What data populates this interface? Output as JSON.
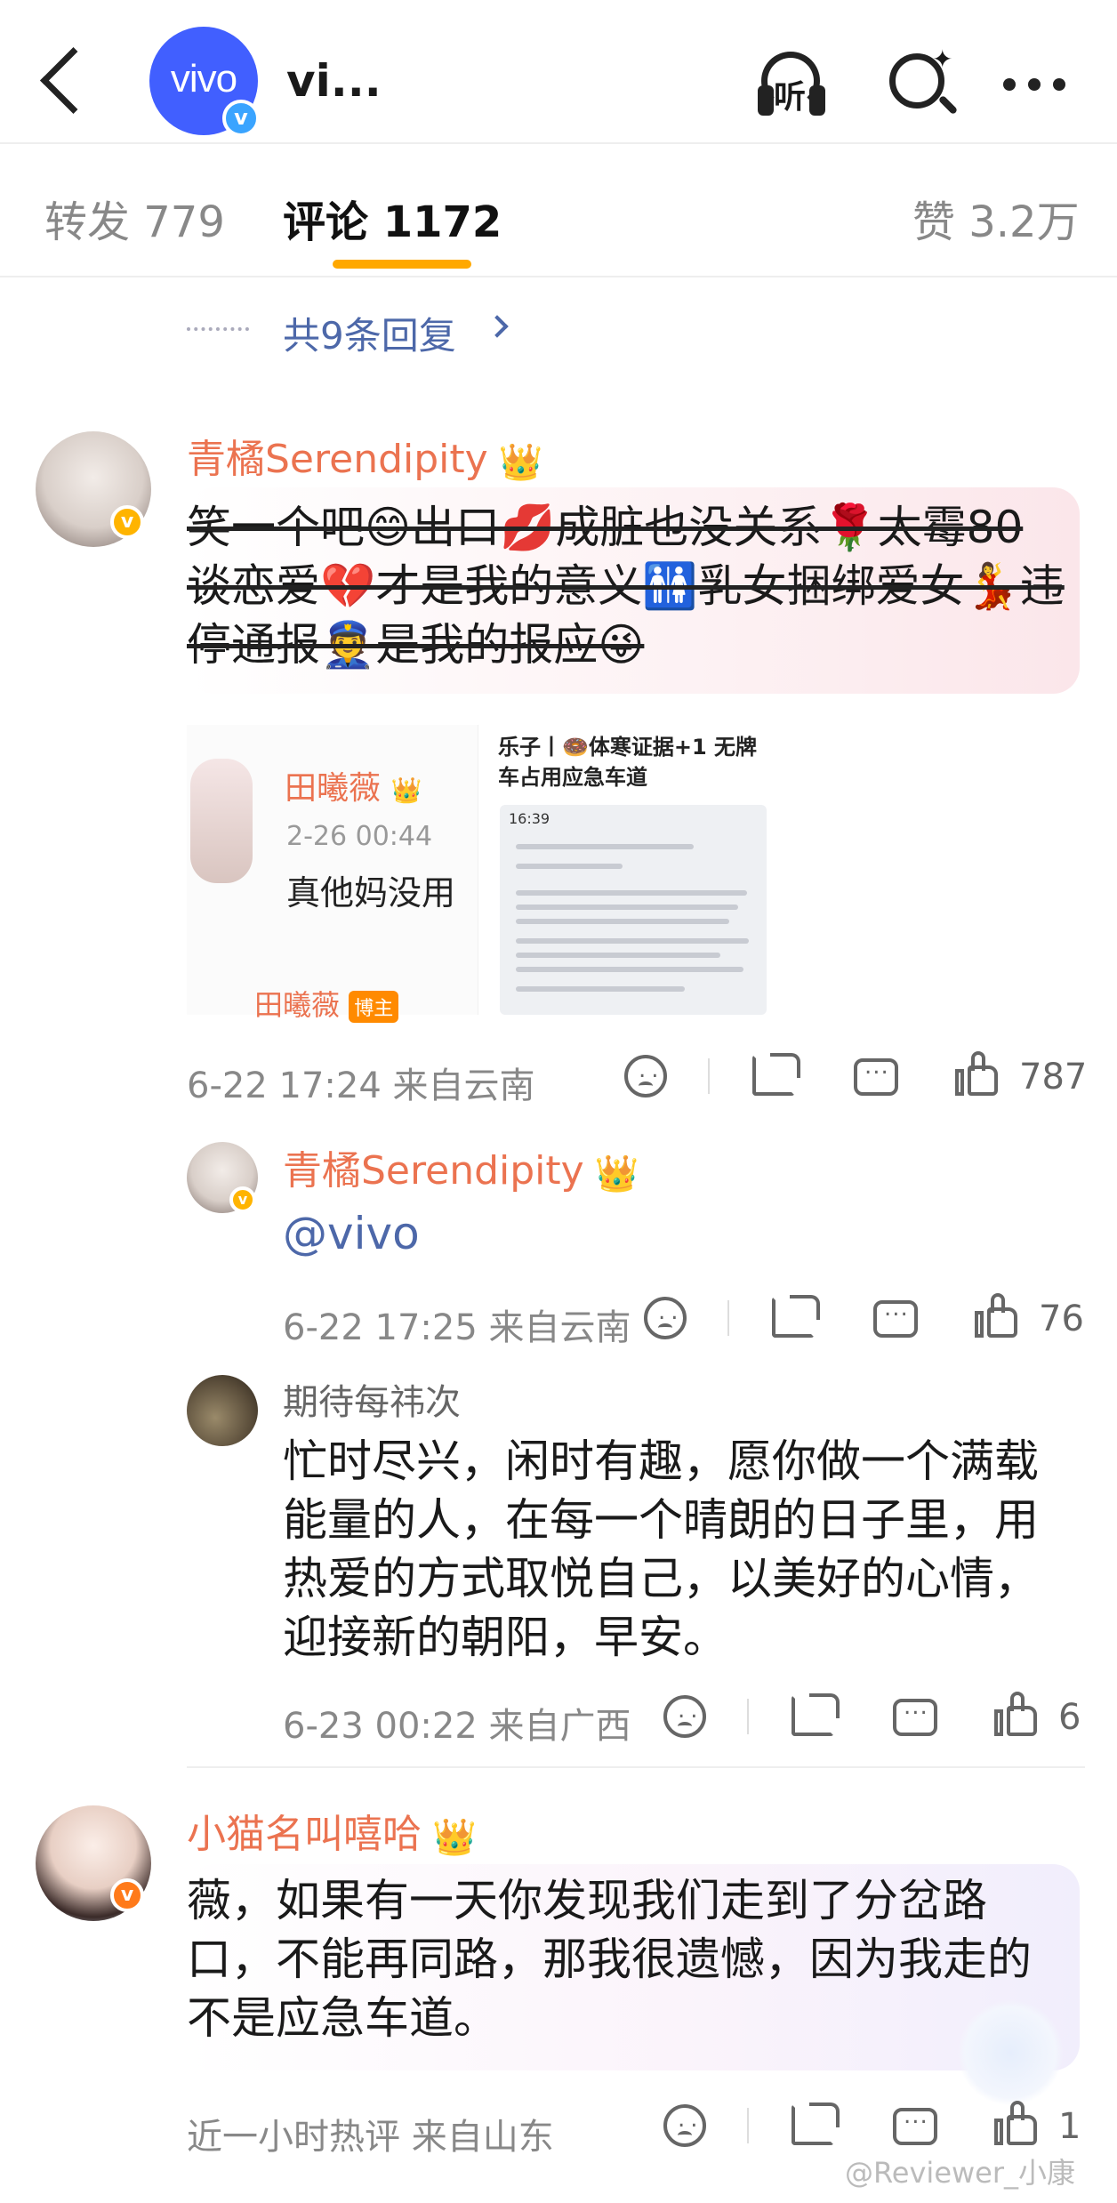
{
  "header": {
    "title": "vi...",
    "logo_text": "vivo",
    "verified_mark": "v",
    "listen_label": "听"
  },
  "tabs": [
    {
      "label": "转发 779"
    },
    {
      "label": "评论 1172"
    },
    {
      "label": "赞 3.2万"
    }
  ],
  "more_replies": "共9条回复",
  "comments": [
    {
      "username": "青橘Serendipity",
      "text": "笑一个吧😊出口💋成脏也没关系🌹太霉80谈恋爱💔才是我的意义🚻乳女捆绑爱女💃违停通报👮是我的报应😜",
      "image1": {
        "name": "田曦薇",
        "time": "2-26 00:44",
        "text": "真他妈没用",
        "footer_name": "田曦薇",
        "footer_tag": "博主"
      },
      "image2": {
        "caption_line1": "乐子丨🍩体寒证据+1 无牌",
        "caption_line2": "车占用应急车道",
        "status_time": "16:39"
      },
      "time": "6-22 17:24",
      "location": "来自云南",
      "likes": "787"
    },
    {
      "username": "青橘Serendipity",
      "text": "@vivo",
      "time": "6-22 17:25",
      "location": "来自云南",
      "likes": "76"
    },
    {
      "username": "期待每祎次",
      "text": "忙时尽兴，闲时有趣，愿你做一个满载能量的人，在每一个晴朗的日子里，用热爱的方式取悦自己，以美好的心情，迎接新的朝阳，早安。",
      "time": "6-23 00:22",
      "location": "来自广西",
      "likes": "6"
    },
    {
      "username": "小猫名叫嘻哈",
      "text": "薇，如果有一天你发现我们走到了分岔路口，不能再同路，那我很遗憾，因为我走的不是应急车道。",
      "time": "近一小时热评",
      "location": "来自山东",
      "likes": "1"
    }
  ],
  "watermark": "@Reviewer_小康",
  "colors": {
    "accent": "#ffa800",
    "username": "#eb7350",
    "link": "#4d68a9",
    "brand": "#415fff"
  }
}
